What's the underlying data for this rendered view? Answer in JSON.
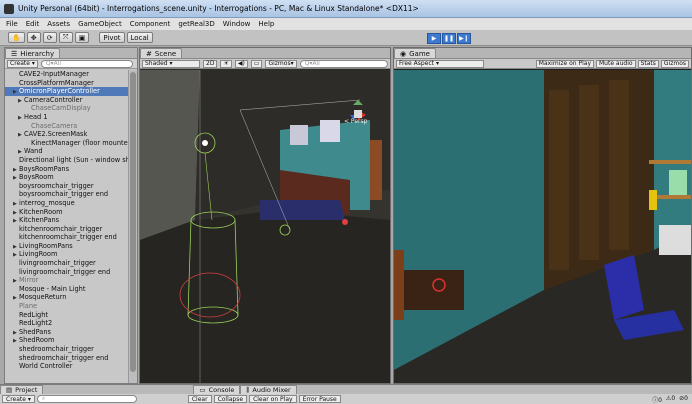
{
  "window": {
    "title": "Unity Personal (64bit) - Interrogations_scene.unity - Interrogations - PC, Mac & Linux Standalone* <DX11>"
  },
  "menu": [
    "File",
    "Edit",
    "Assets",
    "GameObject",
    "Component",
    "getReal3D",
    "Window",
    "Help"
  ],
  "toolbar": {
    "pivot": "Pivot",
    "local": "Local"
  },
  "hierarchy": {
    "tab": "Hierarchy",
    "create": "Create",
    "search_placeholder": "Q▾All",
    "items": [
      {
        "label": "CAVE2-InputManager",
        "level": 0,
        "arrow": false,
        "dim": false,
        "sel": false
      },
      {
        "label": "CrossPlatformManager",
        "level": 0,
        "arrow": false,
        "dim": false,
        "sel": false
      },
      {
        "label": "OmicronPlayerController",
        "level": 0,
        "arrow": true,
        "dim": false,
        "sel": true
      },
      {
        "label": "CameraController",
        "level": 1,
        "arrow": true,
        "dim": false,
        "sel": false
      },
      {
        "label": "ChaseCamDisplay",
        "level": 2,
        "arrow": false,
        "dim": true,
        "sel": false
      },
      {
        "label": "Head 1",
        "level": 1,
        "arrow": true,
        "dim": false,
        "sel": false
      },
      {
        "label": "ChaseCamera",
        "level": 2,
        "arrow": false,
        "dim": true,
        "sel": false
      },
      {
        "label": "CAVE2.ScreenMask",
        "level": 1,
        "arrow": true,
        "dim": false,
        "sel": false
      },
      {
        "label": "KinectManager (floor mounted)",
        "level": 2,
        "arrow": false,
        "dim": false,
        "sel": false
      },
      {
        "label": "Wand",
        "level": 1,
        "arrow": true,
        "dim": false,
        "sel": false
      },
      {
        "label": "Directional light (Sun - window shad",
        "level": 0,
        "arrow": false,
        "dim": false,
        "sel": false
      },
      {
        "label": "BoysRoomPans",
        "level": 0,
        "arrow": true,
        "dim": false,
        "sel": false
      },
      {
        "label": "BoysRoom",
        "level": 0,
        "arrow": true,
        "dim": false,
        "sel": false
      },
      {
        "label": "boysroomchair_trigger",
        "level": 0,
        "arrow": false,
        "dim": false,
        "sel": false
      },
      {
        "label": "boysroomchair_trigger end",
        "level": 0,
        "arrow": false,
        "dim": false,
        "sel": false
      },
      {
        "label": "interrog_mosque",
        "level": 0,
        "arrow": true,
        "dim": false,
        "sel": false
      },
      {
        "label": "KitchenRoom",
        "level": 0,
        "arrow": true,
        "dim": false,
        "sel": false
      },
      {
        "label": "KitchenPans",
        "level": 0,
        "arrow": true,
        "dim": false,
        "sel": false
      },
      {
        "label": "kitchenroomchair_trigger",
        "level": 0,
        "arrow": false,
        "dim": false,
        "sel": false
      },
      {
        "label": "kitchenroomchair_trigger end",
        "level": 0,
        "arrow": false,
        "dim": false,
        "sel": false
      },
      {
        "label": "LivingRoomPans",
        "level": 0,
        "arrow": true,
        "dim": false,
        "sel": false
      },
      {
        "label": "LivingRoom",
        "level": 0,
        "arrow": true,
        "dim": false,
        "sel": false
      },
      {
        "label": "livingroomchair_trigger",
        "level": 0,
        "arrow": false,
        "dim": false,
        "sel": false
      },
      {
        "label": "livingroomchair_trigger end",
        "level": 0,
        "arrow": false,
        "dim": false,
        "sel": false
      },
      {
        "label": "Mirror",
        "level": 0,
        "arrow": true,
        "dim": true,
        "sel": false
      },
      {
        "label": "Mosque - Main Light",
        "level": 0,
        "arrow": false,
        "dim": false,
        "sel": false
      },
      {
        "label": "MosqueReturn",
        "level": 0,
        "arrow": true,
        "dim": false,
        "sel": false
      },
      {
        "label": "Plane",
        "level": 0,
        "arrow": false,
        "dim": true,
        "sel": false
      },
      {
        "label": "RedLight",
        "level": 0,
        "arrow": false,
        "dim": false,
        "sel": false
      },
      {
        "label": "RedLight2",
        "level": 0,
        "arrow": false,
        "dim": false,
        "sel": false
      },
      {
        "label": "ShedPans",
        "level": 0,
        "arrow": true,
        "dim": false,
        "sel": false
      },
      {
        "label": "ShedRoom",
        "level": 0,
        "arrow": true,
        "dim": false,
        "sel": false
      },
      {
        "label": "shedroomchair_trigger",
        "level": 0,
        "arrow": false,
        "dim": false,
        "sel": false
      },
      {
        "label": "shedroomchair_trigger end",
        "level": 0,
        "arrow": false,
        "dim": false,
        "sel": false
      },
      {
        "label": "World Controller",
        "level": 0,
        "arrow": false,
        "dim": false,
        "sel": false
      }
    ]
  },
  "scene": {
    "tab": "Scene",
    "shading": "Shaded",
    "mode_2d": "2D",
    "gizmos": "Gizmos",
    "search_placeholder": "Q▾All",
    "persp": "< Persp"
  },
  "game": {
    "tab": "Game",
    "aspect": "Free Aspect",
    "maximize": "Maximize on Play",
    "mute": "Mute audio",
    "stats": "Stats",
    "gizmos": "Gizmos"
  },
  "bottom": {
    "project_tab": "Project",
    "console_tab": "Console",
    "audio_tab": "Audio Mixer",
    "create": "Create",
    "clear": "Clear",
    "collapse": "Collapse",
    "clear_on_play": "Clear on Play",
    "error_pause": "Error Pause",
    "count_info": "0",
    "count_warn": "0",
    "count_error": "0"
  }
}
